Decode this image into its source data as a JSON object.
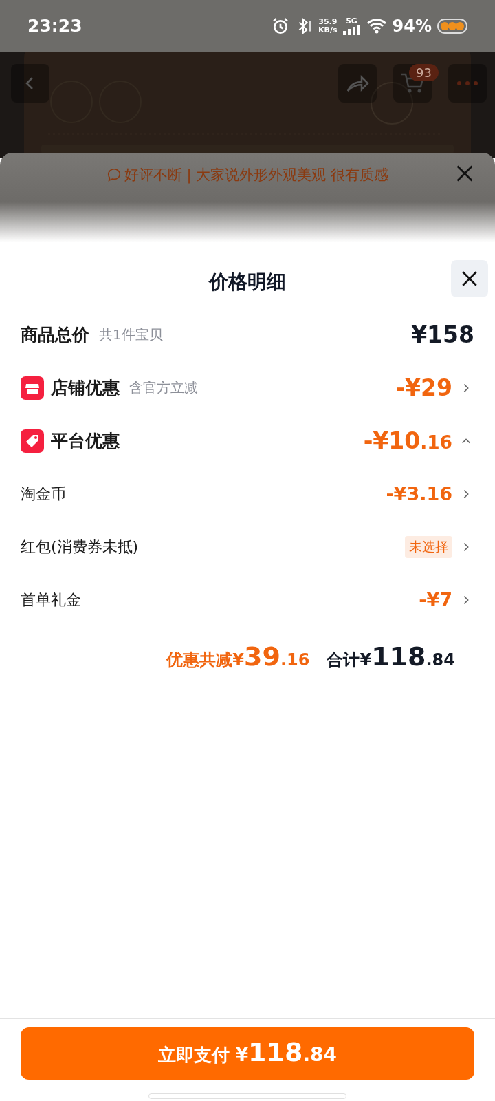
{
  "status_bar": {
    "time": "23:23",
    "speed": "35.9",
    "speed_unit": "KB/s",
    "network": "5G",
    "battery": "94%"
  },
  "nav": {
    "cart_count": "93"
  },
  "toast": {
    "text": "好评不断 | 大家说外形外观美观 很有质感"
  },
  "sheet": {
    "title": "价格明细",
    "rows": [
      {
        "kind": "total",
        "label": "商品总价",
        "note": "共1件宝贝",
        "amount": {
          "main": "¥158"
        }
      },
      {
        "kind": "shop_discount",
        "label": "店铺优惠",
        "note": "含官方立减",
        "amount": {
          "main": "-¥29"
        },
        "more": true
      },
      {
        "kind": "platform_discount",
        "label": "平台优惠",
        "amount": {
          "main": "-¥10",
          "fraction": ".16"
        },
        "expanded": true
      },
      {
        "kind": "item",
        "label": "淘金币",
        "amount": {
          "main": "-¥3.16"
        },
        "more": true
      },
      {
        "kind": "item",
        "label": "红包(消费券未抵)",
        "badge": "未选择",
        "more": true
      },
      {
        "kind": "item",
        "label": "首单礼金",
        "amount": {
          "main": "-¥7"
        },
        "more": true
      }
    ],
    "summary": {
      "discount_label": "优惠共减¥",
      "discount_main": "39",
      "discount_fraction": ".16",
      "total_label": "合计¥",
      "total_main": "118",
      "total_fraction": ".84"
    },
    "pay_button": {
      "label": "立即支付 ¥",
      "main": "118",
      "fraction": ".84"
    }
  }
}
